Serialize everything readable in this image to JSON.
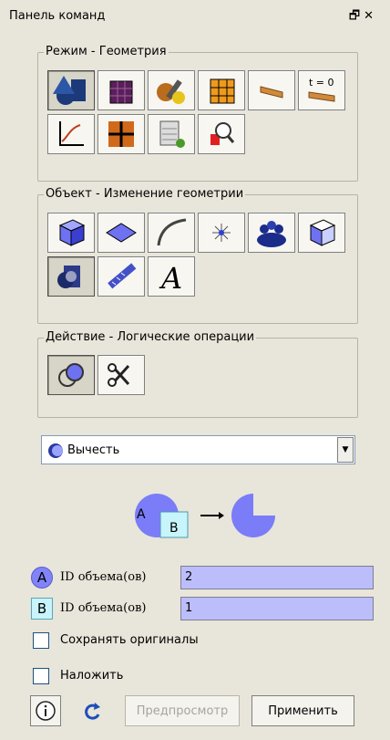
{
  "panel": {
    "title": "Панель команд",
    "float_icon": "restore-icon",
    "close_icon": "close-icon"
  },
  "mode_group": {
    "title": "Режим - Геометрия",
    "buttons": [
      "geometry-mode-icon",
      "mesh-mode-icon",
      "tools-mode-icon",
      "cube-mesh-icon",
      "boundary-icon",
      "time-zero-icon",
      "plot-icon",
      "grid-icon",
      "calculator-icon",
      "zoom-select-icon"
    ]
  },
  "object_group": {
    "title": "Объект - Изменение геометрии",
    "buttons": [
      "volume-icon",
      "surface-icon",
      "curve-icon",
      "vertex-icon",
      "group-icon",
      "cube-outline-icon",
      "transform-icon",
      "measure-icon",
      "text-icon"
    ]
  },
  "action_group": {
    "title": "Действие - Логические операции",
    "buttons": [
      "boolean-icon",
      "split-icon"
    ]
  },
  "operation": {
    "selected": "Вычесть",
    "icon": "subtract-icon"
  },
  "diagram": {
    "a": "A",
    "b": "B"
  },
  "fields": {
    "a_badge": "A",
    "a_label": "ID объема(ов)",
    "a_value": "2",
    "b_badge": "B",
    "b_label": "ID объема(ов)",
    "b_value": "1"
  },
  "options": {
    "keep_originals": "Сохранять оригиналы",
    "imprint": "Наложить"
  },
  "footer": {
    "preview": "Предпросмотр",
    "apply": "Применить"
  }
}
